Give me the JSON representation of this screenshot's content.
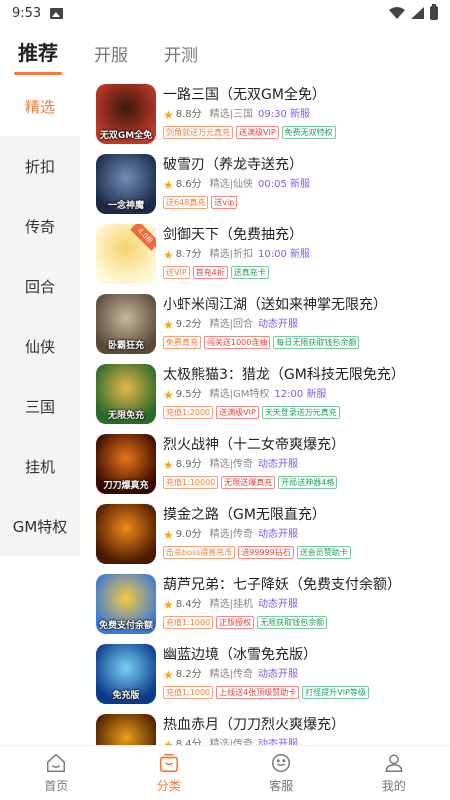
{
  "status": {
    "time": "9:53"
  },
  "top_tabs": [
    {
      "label": "推荐"
    },
    {
      "label": "开服"
    },
    {
      "label": "开测"
    }
  ],
  "sidebar": {
    "items": [
      {
        "label": "精选"
      },
      {
        "label": "折扣"
      },
      {
        "label": "传奇"
      },
      {
        "label": "回合"
      },
      {
        "label": "仙侠"
      },
      {
        "label": "三国"
      },
      {
        "label": "挂机"
      },
      {
        "label": "GM特权"
      }
    ]
  },
  "games": [
    {
      "title": "一路三国（无双GM全免）",
      "score": "8.8分",
      "genre": "精选|三国",
      "time": "09:30 新服",
      "icon_text": "无双GM全免",
      "icon_colors": [
        "#c0392b",
        "#3a1a0a"
      ],
      "tags": [
        {
          "text": "剑角就送万元真充",
          "color": "orange"
        },
        {
          "text": "送满级VIP",
          "color": "red"
        },
        {
          "text": "免费无双特权",
          "color": "green"
        }
      ]
    },
    {
      "title": "破雪刃（养龙寺送充）",
      "score": "8.6分",
      "genre": "精选|仙侠",
      "time": "00:05 新服",
      "icon_text": "一念神魔",
      "icon_colors": [
        "#1b2a4a",
        "#6f8fb8"
      ],
      "tags": [
        {
          "text": "送648真充",
          "color": "orange"
        },
        {
          "text": "送vip",
          "color": "red"
        }
      ]
    },
    {
      "title": "剑御天下（免费抽充）",
      "score": "8.7分",
      "genre": "精选|折扣",
      "time": "10:00 新服",
      "icon_text": "",
      "icon_badge": "4.0折",
      "icon_colors": [
        "#fff7d6",
        "#f5d36b"
      ],
      "tags": [
        {
          "text": "送VIP",
          "color": "orange"
        },
        {
          "text": "首充4折",
          "color": "red"
        },
        {
          "text": "送真充卡",
          "color": "green"
        }
      ]
    },
    {
      "title": "小虾米闯江湖（送如来神掌无限充）",
      "score": "9.2分",
      "genre": "精选|回合",
      "time": "动态开服",
      "icon_text": "卧霸狂充",
      "icon_colors": [
        "#5a4a3a",
        "#c9b79a"
      ],
      "tags": [
        {
          "text": "免费真充",
          "color": "orange"
        },
        {
          "text": "闯关送1000连抽",
          "color": "red"
        },
        {
          "text": "每日无限获取钱包余额",
          "color": "green"
        }
      ]
    },
    {
      "title": "太极熊猫3：猎龙（GM科技无限免充）",
      "score": "9.5分",
      "genre": "精选|GM特权",
      "time": "12:00 新服",
      "icon_text": "无限免充",
      "icon_colors": [
        "#2a6a2a",
        "#e8b64a"
      ],
      "tags": [
        {
          "text": "充值1:2000",
          "color": "orange"
        },
        {
          "text": "送满级VIP",
          "color": "red"
        },
        {
          "text": "天天登录送万元真充",
          "color": "green"
        }
      ]
    },
    {
      "title": "烈火战神（十二女帝爽爆充）",
      "score": "8.9分",
      "genre": "精选|传奇",
      "time": "动态开服",
      "icon_text": "刀刀爆真充",
      "icon_colors": [
        "#3a0a00",
        "#e8761a"
      ],
      "tags": [
        {
          "text": "充值1:10000",
          "color": "orange"
        },
        {
          "text": "无限送爆真充",
          "color": "red"
        },
        {
          "text": "开局送神器4格",
          "color": "green"
        }
      ]
    },
    {
      "title": "摸金之路（GM无限直充）",
      "score": "9.0分",
      "genre": "精选|传奇",
      "time": "动态开服",
      "icon_text": "",
      "icon_colors": [
        "#4a1a00",
        "#f08a1a"
      ],
      "tags": [
        {
          "text": "击杀boss得直充币",
          "color": "orange"
        },
        {
          "text": "送99999钻石",
          "color": "red"
        },
        {
          "text": "送会员赞助卡",
          "color": "green"
        }
      ]
    },
    {
      "title": "葫芦兄弟：七子降妖（免费支付余额）",
      "score": "8.4分",
      "genre": "精选|挂机",
      "time": "动态开服",
      "icon_text": "免费支付余额",
      "icon_colors": [
        "#3a7ad8",
        "#f5c842"
      ],
      "tags": [
        {
          "text": "充值1:1000",
          "color": "orange"
        },
        {
          "text": "正版授权",
          "color": "red"
        },
        {
          "text": "无限获取钱包余额",
          "color": "green"
        }
      ]
    },
    {
      "title": "幽蓝边境（冰雪免充版）",
      "score": "8.2分",
      "genre": "精选|传奇",
      "time": "动态开服",
      "icon_text": "免充版",
      "icon_colors": [
        "#0a3a8a",
        "#7ad0f5"
      ],
      "tags": [
        {
          "text": "充值1:1000",
          "color": "orange"
        },
        {
          "text": "上线送4张顶级赞助卡",
          "color": "red"
        },
        {
          "text": "打怪提升VIP等级",
          "color": "green"
        }
      ]
    },
    {
      "title": "热血赤月（刀刀烈火爽爆充）",
      "score": "8.4分",
      "genre": "精选|传奇",
      "time": "动态开服",
      "icon_text": "",
      "icon_colors": [
        "#4a1a00",
        "#e8a01a"
      ],
      "tags": []
    }
  ],
  "bottom_nav": [
    {
      "label": "首页",
      "icon": "home-icon"
    },
    {
      "label": "分类",
      "icon": "category-icon"
    },
    {
      "label": "客服",
      "icon": "customer-service-icon"
    },
    {
      "label": "我的",
      "icon": "profile-icon"
    }
  ],
  "colors": {
    "accent": "#f27b3a",
    "new_server": "#7a5af8"
  }
}
